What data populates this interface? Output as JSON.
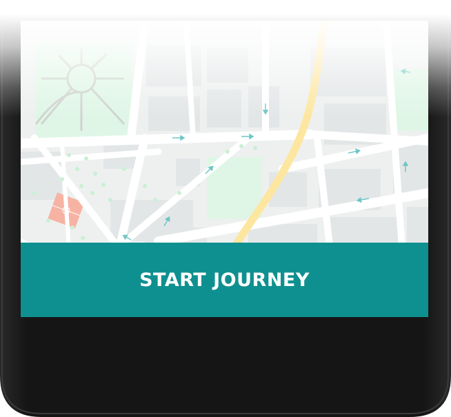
{
  "journey_button": {
    "label": "START JOURNEY",
    "color": "#0f9090",
    "text_color": "#ffffff"
  },
  "theme": {
    "device_color": "#141414",
    "map_background": "#eef0f0",
    "road_color": "#ffffff",
    "highway_color": "#fde6a0",
    "park_color": "#dff6e6",
    "building_color": "#e3e6e7",
    "pitch_color": "#f6b3a3",
    "direction_arrow_color": "#6ec6c6"
  },
  "icons": {
    "direction_arrow": "arrow-icon"
  }
}
